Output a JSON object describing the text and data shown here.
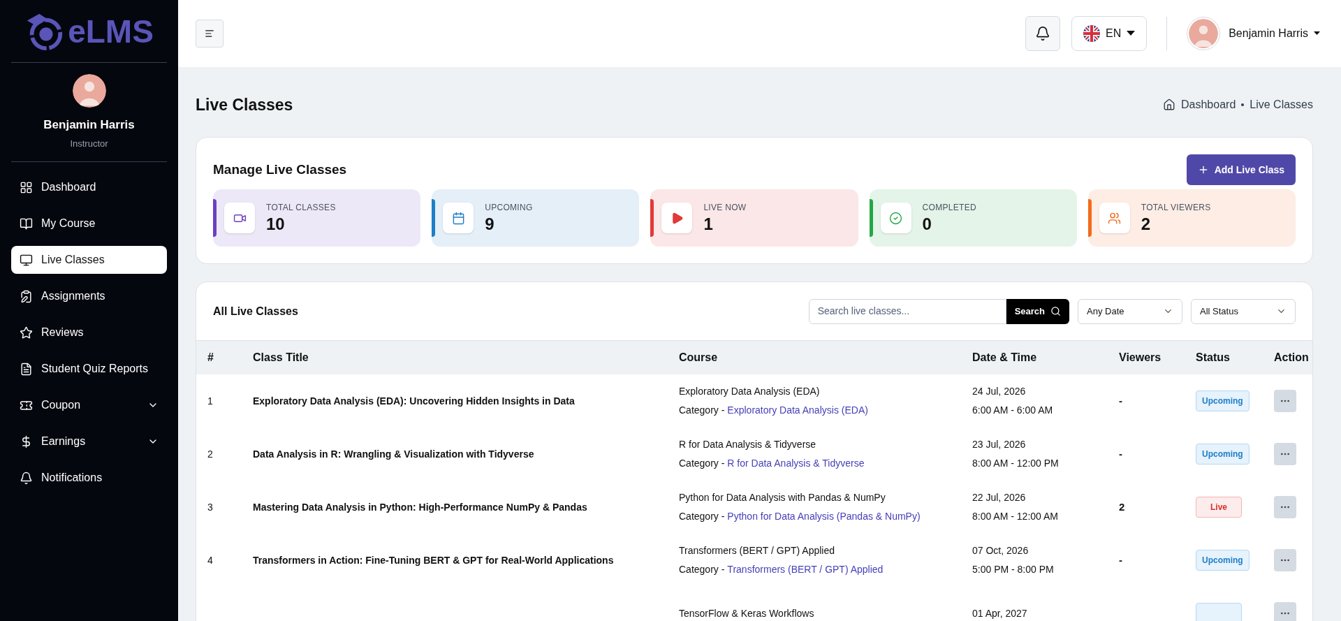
{
  "brand": {
    "name": "eLMS"
  },
  "profile": {
    "name": "Benjamin Harris",
    "role": "Instructor"
  },
  "sidebar": {
    "items": [
      {
        "label": "Dashboard",
        "kind": "link",
        "selected": false
      },
      {
        "label": "My Course",
        "kind": "link",
        "selected": false
      },
      {
        "label": "Live Classes",
        "kind": "link",
        "selected": true
      },
      {
        "label": "Assignments",
        "kind": "link",
        "selected": false
      },
      {
        "label": "Reviews",
        "kind": "link",
        "selected": false
      },
      {
        "label": "Student Quiz Reports",
        "kind": "link",
        "selected": false
      },
      {
        "label": "Coupon",
        "kind": "group",
        "expanded": false,
        "selected": false
      },
      {
        "label": "Earnings",
        "kind": "group",
        "expanded": false,
        "selected": false
      },
      {
        "label": "Notifications",
        "kind": "link",
        "selected": false
      }
    ]
  },
  "topbar": {
    "language": "EN",
    "user": "Benjamin Harris"
  },
  "page": {
    "title": "Live Classes",
    "breadcrumb": [
      "Dashboard",
      "Live Classes"
    ]
  },
  "summary": {
    "title": "Manage Live Classes",
    "add_button": "Add Live Class",
    "stats": [
      {
        "label": "TOTAL CLASSES",
        "value": "10",
        "color": "#6d3fc0"
      },
      {
        "label": "UPCOMING",
        "value": "9",
        "color": "#1e7fc8"
      },
      {
        "label": "LIVE NOW",
        "value": "1",
        "color": "#e03a3a"
      },
      {
        "label": "COMPLETED",
        "value": "0",
        "color": "#22a845"
      },
      {
        "label": "TOTAL VIEWERS",
        "value": "2",
        "color": "#f26b1d"
      }
    ]
  },
  "table": {
    "title": "All Live Classes",
    "search": {
      "placeholder": "Search live classes...",
      "button": "Search"
    },
    "filters": [
      {
        "value": "Any Date"
      },
      {
        "value": "All Status"
      }
    ],
    "columns": [
      "#",
      "Class Title",
      "Course",
      "Date & Time",
      "Viewers",
      "Status",
      "Action"
    ],
    "rows": [
      {
        "index": "1",
        "title": "Exploratory Data Analysis (EDA): Uncovering Hidden Insights in Data",
        "course": "Exploratory Data Analysis (EDA)",
        "category_label": "Category -",
        "category": "Exploratory Data Analysis (EDA)",
        "date": "24 Jul, 2026",
        "time": "6:00 AM - 6:00 AM",
        "viewers": "-",
        "status": "Upcoming",
        "kind": "upcoming"
      },
      {
        "index": "2",
        "title": "Data Analysis in R: Wrangling & Visualization with Tidyverse",
        "course": "R for Data Analysis & Tidyverse",
        "category_label": "Category -",
        "category": "R for Data Analysis & Tidyverse",
        "date": "23 Jul, 2026",
        "time": "8:00 AM - 12:00 PM",
        "viewers": "-",
        "status": "Upcoming",
        "kind": "upcoming"
      },
      {
        "index": "3",
        "title": "Mastering Data Analysis in Python: High-Performance NumPy & Pandas",
        "course": "Python for Data Analysis with Pandas & NumPy",
        "category_label": "Category -",
        "category": "Python for Data Analysis (Pandas & NumPy)",
        "date": "22 Jul, 2026",
        "time": "8:00 AM - 12:00 AM",
        "viewers": "2",
        "status": "Live",
        "kind": "live"
      },
      {
        "index": "4",
        "title": "Transformers in Action: Fine-Tuning BERT & GPT for Real-World Applications",
        "course": "Transformers (BERT / GPT) Applied",
        "category_label": "Category -",
        "category": "Transformers (BERT / GPT) Applied",
        "date": "07 Oct, 2026",
        "time": "5:00 PM - 8:00 PM",
        "viewers": "-",
        "status": "Upcoming",
        "kind": "upcoming"
      },
      {
        "course": "TensorFlow & Keras Workflows",
        "date": "01 Apr, 2027",
        "kind": "upcoming"
      }
    ]
  }
}
